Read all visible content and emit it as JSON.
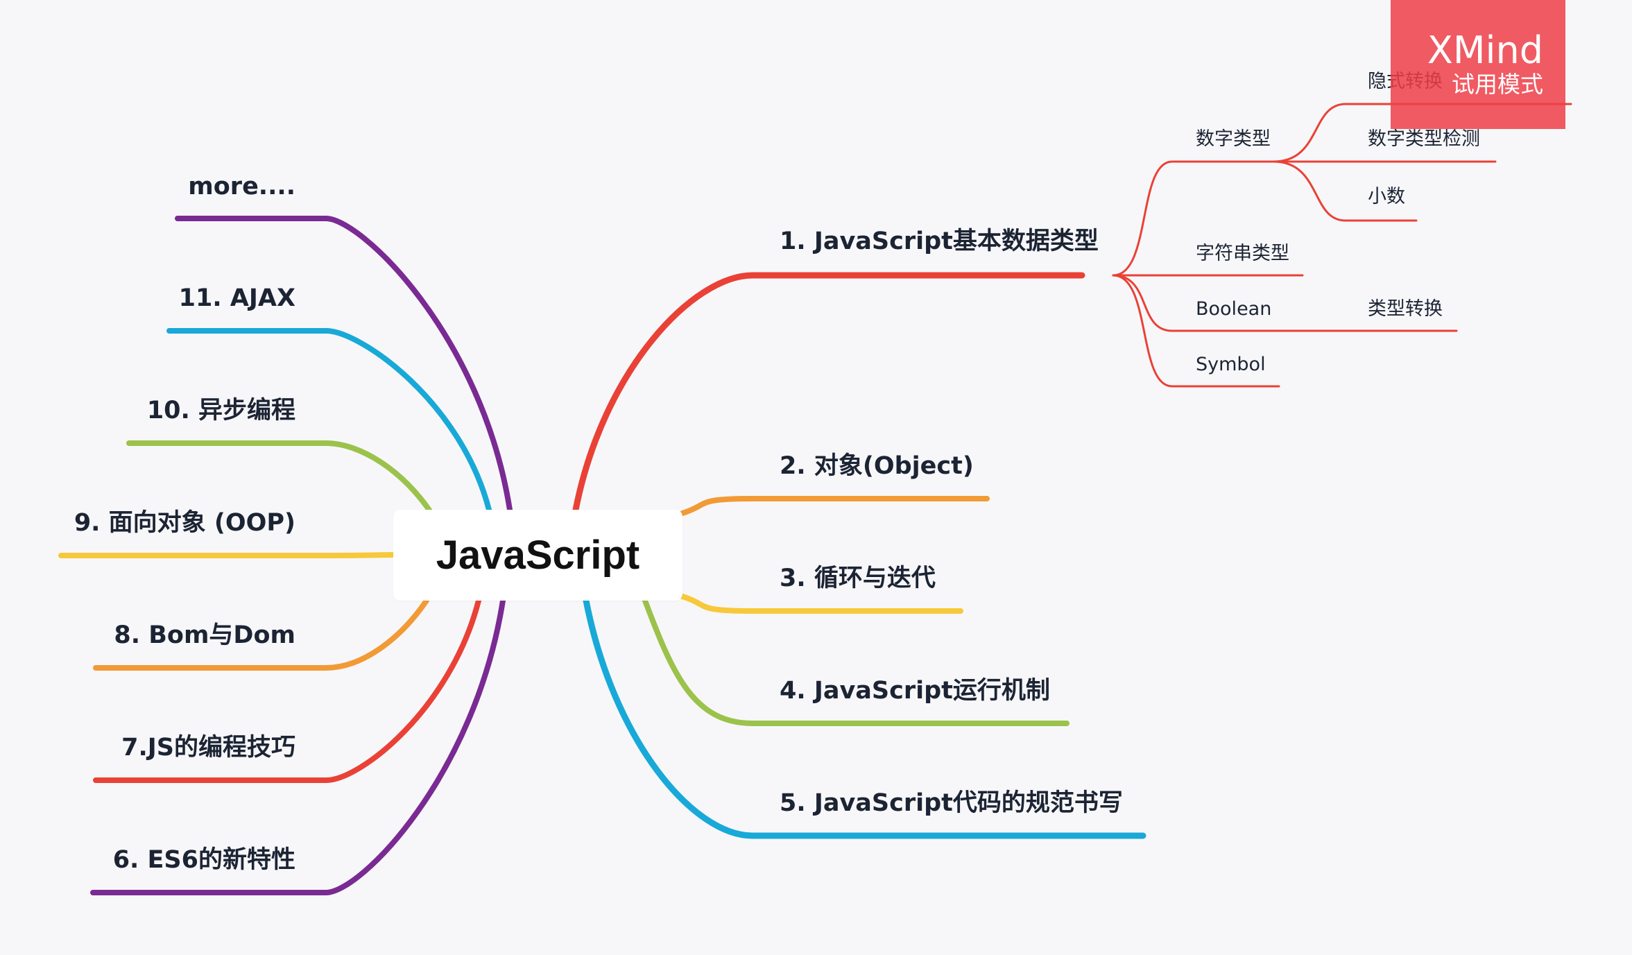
{
  "central": {
    "label": "JavaScript"
  },
  "right_branches": [
    {
      "label": "1. JavaScript基本数据类型",
      "color": "#ea4136"
    },
    {
      "label": "2. 对象(Object)",
      "color": "#f29a35"
    },
    {
      "label": "3. 循环与迭代",
      "color": "#f7c83a"
    },
    {
      "label": "4. JavaScript运行机制",
      "color": "#9bc24b"
    },
    {
      "label": "5. JavaScript代码的规范书写",
      "color": "#18a9d8"
    }
  ],
  "left_branches": [
    {
      "label": "more....",
      "color": "#7a2a93"
    },
    {
      "label": "11. AJAX",
      "color": "#18a9d8"
    },
    {
      "label": "10. 异步编程",
      "color": "#9bc24b"
    },
    {
      "label": "9. 面向对象 (OOP)",
      "color": "#f7c83a"
    },
    {
      "label": "8. Bom与Dom",
      "color": "#f29a35"
    },
    {
      "label": "7.JS的编程技巧",
      "color": "#ea4136"
    },
    {
      "label": "6. ES6的新特性",
      "color": "#7a2a93"
    }
  ],
  "subtopics_branch1": [
    {
      "label": "数字类型"
    },
    {
      "label": "字符串类型"
    },
    {
      "label": "Boolean"
    },
    {
      "label": "Symbol"
    }
  ],
  "subtopics_number": [
    {
      "label": "隐式转换"
    },
    {
      "label": "数字类型检测"
    },
    {
      "label": "小数"
    }
  ],
  "subtopics_boolean": [
    {
      "label": "类型转换"
    }
  ],
  "watermark": {
    "title": "XMind",
    "subtitle": "试用模式"
  }
}
